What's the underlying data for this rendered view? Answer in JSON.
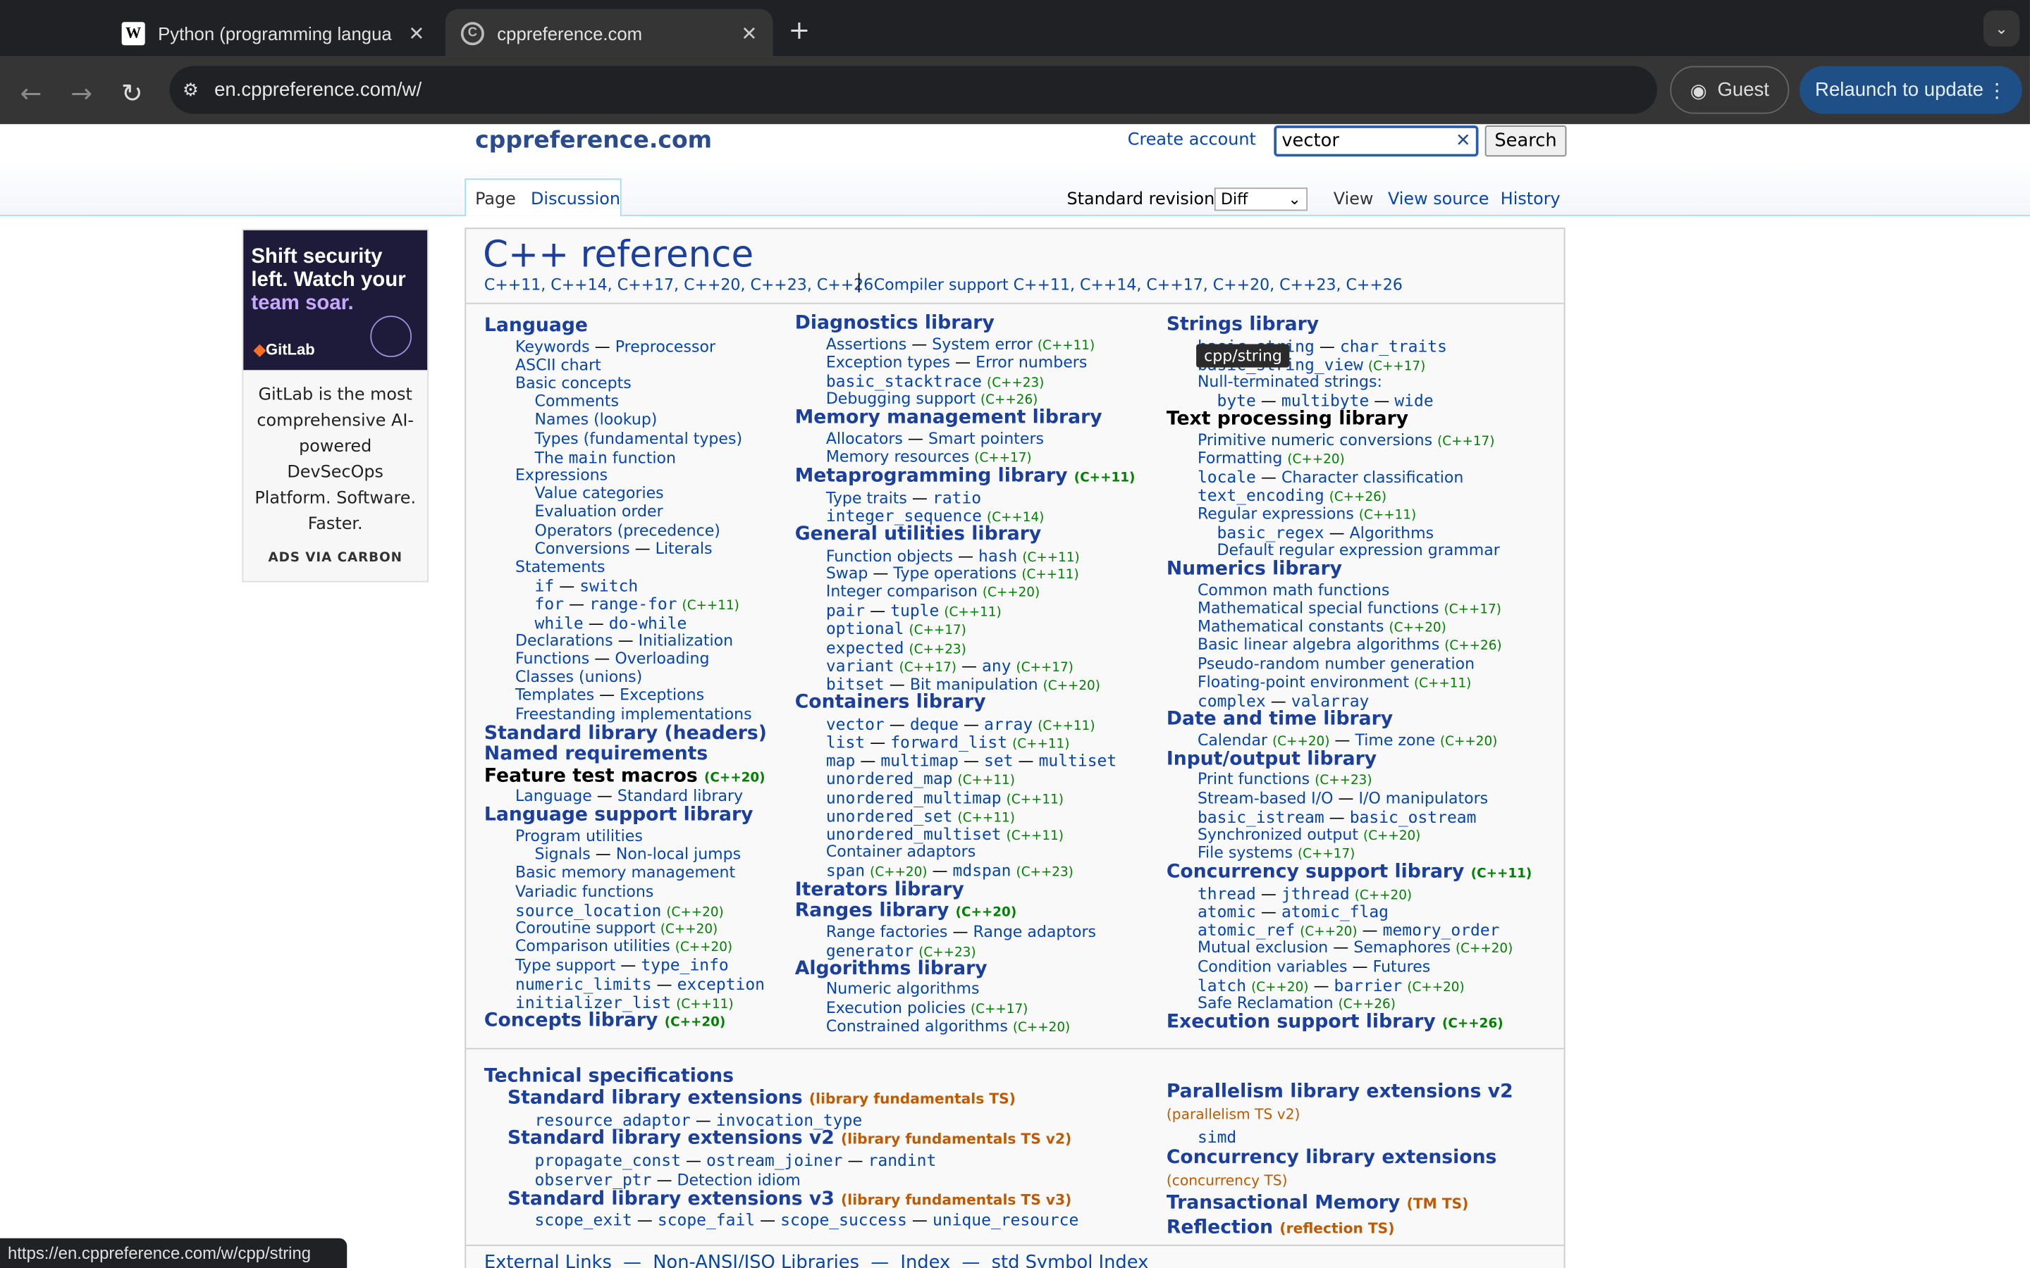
{
  "tabs": [
    {
      "label": "Python (programming langua",
      "icon": "wikipedia-w-icon"
    },
    {
      "label": "cppreference.com",
      "icon": "cppreference-icon"
    }
  ],
  "url": "en.cppreference.com/w/",
  "guest_label": "Guest",
  "relaunch_label": "Relaunch to update",
  "site": {
    "title": "cppreference.com",
    "create_account": "Create account",
    "search_value": "vector",
    "search_button": "Search"
  },
  "page_tabs": {
    "page": "Page",
    "discussion": "Discussion",
    "std_rev_label": "Standard revision:",
    "std_rev_value": "Diff",
    "view": "View",
    "view_source": "View source",
    "history": "History"
  },
  "ad": {
    "headline_white": "Shift security left. Watch your",
    "headline_accent": "team soar.",
    "brand": "GitLab",
    "body": "GitLab is the most comprehensive AI-powered DevSecOps Platform. Software. Faster.",
    "footer": "ADS VIA CARBON"
  },
  "heading": "C++ reference",
  "versions": "C++11, C++14, C++17, C++20, C++23, C++26",
  "compiler_support": "Compiler support C++11, C++14, C++17, C++20, C++23, C++26",
  "tooltip": "cpp/string",
  "status_url": "https://en.cppreference.com/w/cpp/string",
  "bottom_links": "External Links  —  Non-ANSI/ISO Libraries  —  Index  —  std Symbol Index",
  "col1": [
    [
      "h",
      "Language"
    ],
    [
      "i",
      "Keywords — Preprocessor"
    ],
    [
      "i",
      "ASCII chart"
    ],
    [
      "i",
      "Basic concepts"
    ],
    [
      "j",
      "Comments"
    ],
    [
      "j",
      "Names (lookup)"
    ],
    [
      "j",
      "Types (fundamental types)"
    ],
    [
      "j",
      "The main function"
    ],
    [
      "i",
      "Expressions"
    ],
    [
      "j",
      "Value categories"
    ],
    [
      "j",
      "Evaluation order"
    ],
    [
      "j",
      "Operators (precedence)"
    ],
    [
      "j",
      "Conversions — Literals"
    ],
    [
      "i",
      "Statements"
    ],
    [
      "j",
      "if — switch"
    ],
    [
      "j",
      "for — range-for (C++11)"
    ],
    [
      "j",
      "while — do-while"
    ],
    [
      "i",
      "Declarations — Initialization"
    ],
    [
      "i",
      "Functions — Overloading"
    ],
    [
      "i",
      "Classes (unions)"
    ],
    [
      "i",
      "Templates — Exceptions"
    ],
    [
      "i",
      "Freestanding implementations"
    ],
    [
      "h",
      "Standard library (headers)"
    ],
    [
      "h",
      "Named requirements"
    ],
    [
      "k",
      "Feature test macros (C++20)"
    ],
    [
      "i",
      "Language — Standard library"
    ],
    [
      "h",
      "Language support library"
    ],
    [
      "i",
      "Program utilities"
    ],
    [
      "j",
      "Signals — Non-local jumps"
    ],
    [
      "i",
      "Basic memory management"
    ],
    [
      "i",
      "Variadic functions"
    ],
    [
      "i",
      "source_location (C++20)"
    ],
    [
      "i",
      "Coroutine support (C++20)"
    ],
    [
      "i",
      "Comparison utilities (C++20)"
    ],
    [
      "i",
      "Type support — type_info"
    ],
    [
      "i",
      "numeric_limits — exception"
    ],
    [
      "i",
      "initializer_list (C++11)"
    ],
    [
      "h",
      "Concepts library (C++20)"
    ]
  ],
  "col2": [
    [
      "h",
      "Diagnostics library"
    ],
    [
      "i",
      "Assertions — System error (C++11)"
    ],
    [
      "i",
      "Exception types — Error numbers"
    ],
    [
      "i",
      "basic_stacktrace (C++23)"
    ],
    [
      "i",
      "Debugging support (C++26)"
    ],
    [
      "h",
      "Memory management library"
    ],
    [
      "i",
      "Allocators — Smart pointers"
    ],
    [
      "i",
      "Memory resources (C++17)"
    ],
    [
      "h",
      "Metaprogramming library (C++11)"
    ],
    [
      "i",
      "Type traits — ratio"
    ],
    [
      "i",
      "integer_sequence (C++14)"
    ],
    [
      "h",
      "General utilities library"
    ],
    [
      "i",
      "Function objects — hash (C++11)"
    ],
    [
      "i",
      "Swap — Type operations (C++11)"
    ],
    [
      "i",
      "Integer comparison (C++20)"
    ],
    [
      "i",
      "pair — tuple (C++11)"
    ],
    [
      "i",
      "optional (C++17)"
    ],
    [
      "i",
      "expected (C++23)"
    ],
    [
      "i",
      "variant (C++17) — any (C++17)"
    ],
    [
      "i",
      "bitset — Bit manipulation (C++20)"
    ],
    [
      "h",
      "Containers library"
    ],
    [
      "i",
      "vector — deque — array (C++11)"
    ],
    [
      "i",
      "list — forward_list (C++11)"
    ],
    [
      "i",
      "map — multimap — set — multiset"
    ],
    [
      "i",
      "unordered_map (C++11)"
    ],
    [
      "i",
      "unordered_multimap (C++11)"
    ],
    [
      "i",
      "unordered_set (C++11)"
    ],
    [
      "i",
      "unordered_multiset (C++11)"
    ],
    [
      "i",
      "Container adaptors"
    ],
    [
      "i",
      "span (C++20) — mdspan (C++23)"
    ],
    [
      "h",
      "Iterators library"
    ],
    [
      "h",
      "Ranges library (C++20)"
    ],
    [
      "i",
      "Range factories — Range adaptors"
    ],
    [
      "i",
      "generator (C++23)"
    ],
    [
      "h",
      "Algorithms library"
    ],
    [
      "i",
      "Numeric algorithms"
    ],
    [
      "i",
      "Execution policies (C++17)"
    ],
    [
      "i",
      "Constrained algorithms (C++20)"
    ]
  ],
  "col3": [
    [
      "h",
      "Strings library"
    ],
    [
      "i",
      "basic_string — char_traits"
    ],
    [
      "i",
      "basic_string_view (C++17)"
    ],
    [
      "i",
      "Null-terminated strings:"
    ],
    [
      "j",
      "byte — multibyte — wide"
    ],
    [
      "k",
      "Text processing library"
    ],
    [
      "i",
      "Primitive numeric conversions (C++17)"
    ],
    [
      "i",
      "Formatting (C++20)"
    ],
    [
      "i",
      "locale — Character classification"
    ],
    [
      "i",
      "text_encoding (C++26)"
    ],
    [
      "i",
      "Regular expressions (C++11)"
    ],
    [
      "j",
      "basic_regex — Algorithms"
    ],
    [
      "j",
      "Default regular expression grammar"
    ],
    [
      "h",
      "Numerics library"
    ],
    [
      "i",
      "Common math functions"
    ],
    [
      "i",
      "Mathematical special functions (C++17)"
    ],
    [
      "i",
      "Mathematical constants (C++20)"
    ],
    [
      "i",
      "Basic linear algebra algorithms (C++26)"
    ],
    [
      "i",
      "Pseudo-random number generation"
    ],
    [
      "i",
      "Floating-point environment (C++11)"
    ],
    [
      "i",
      "complex — valarray"
    ],
    [
      "h",
      "Date and time library"
    ],
    [
      "i",
      "Calendar (C++20) — Time zone (C++20)"
    ],
    [
      "h",
      "Input/output library"
    ],
    [
      "i",
      "Print functions (C++23)"
    ],
    [
      "i",
      "Stream-based I/O — I/O manipulators"
    ],
    [
      "i",
      "basic_istream — basic_ostream"
    ],
    [
      "i",
      "Synchronized output (C++20)"
    ],
    [
      "i",
      "File systems (C++17)"
    ],
    [
      "h",
      "Concurrency support library (C++11)"
    ],
    [
      "i",
      "thread — jthread (C++20)"
    ],
    [
      "i",
      "atomic — atomic_flag"
    ],
    [
      "i",
      "atomic_ref (C++20) — memory_order"
    ],
    [
      "i",
      "Mutual exclusion — Semaphores (C++20)"
    ],
    [
      "i",
      "Condition variables — Futures"
    ],
    [
      "i",
      "latch (C++20) — barrier (C++20)"
    ],
    [
      "i",
      "Safe Reclamation (C++26)"
    ],
    [
      "h",
      "Execution support library (C++26)"
    ]
  ],
  "tech": [
    [
      "h",
      "Technical specifications"
    ],
    [
      "s",
      "Standard library extensions  (library fundamentals TS)"
    ],
    [
      "j",
      "resource_adaptor — invocation_type"
    ],
    [
      "s",
      "Standard library extensions v2  (library fundamentals TS v2)"
    ],
    [
      "j",
      "propagate_const — ostream_joiner — randint"
    ],
    [
      "j",
      "observer_ptr — Detection idiom"
    ],
    [
      "s",
      "Standard library extensions v3  (library fundamentals TS v3)"
    ],
    [
      "j",
      "scope_exit — scope_fail — scope_success — unique_resource"
    ]
  ],
  "tech2": [
    [
      "h",
      "Parallelism library extensions v2"
    ],
    [
      "t",
      "(parallelism TS v2)"
    ],
    [
      "i",
      "simd"
    ],
    [
      "h",
      "Concurrency library extensions"
    ],
    [
      "t",
      "(concurrency TS)"
    ],
    [
      "h",
      "Transactional Memory  (TM TS)"
    ],
    [
      "h",
      "Reflection  (reflection TS)"
    ]
  ]
}
